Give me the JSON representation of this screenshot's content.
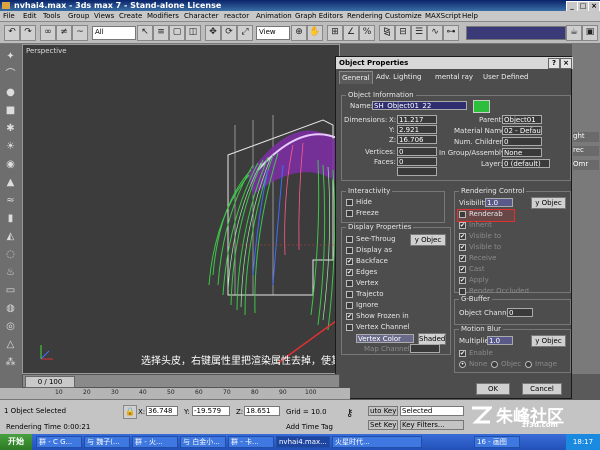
{
  "window": {
    "title": "nvhai4.max - 3ds max 7  - Stand-alone License"
  },
  "menu": [
    "File",
    "Edit",
    "Tools",
    "Group",
    "Views",
    "Create",
    "Modifiers",
    "Character",
    "reactor",
    "Animation",
    "Graph Editors",
    "Rendering",
    "Customize",
    "MAXScript",
    "Help"
  ],
  "toolbar": {
    "selection_filter": "All",
    "ref_coord": "View"
  },
  "viewport": {
    "label": "Perspective",
    "subtitle": "选择头皮，右键属性里把渲染属性去掉，使其不被渲染"
  },
  "right_panel": {
    "labels": [
      "ght",
      "rec",
      "Omr"
    ]
  },
  "dialog": {
    "title": "Object Properties",
    "tabs": [
      "General",
      "Adv. Lighting",
      "mental ray",
      "User Defined"
    ],
    "object_info": {
      "group_title": "Object Information",
      "name_label": "Name:",
      "name_value": "SH_Object01_22",
      "color": "#2dbe3c",
      "dimensions_label": "Dimensions:",
      "x_label": "X:",
      "x": "11.217",
      "y_label": "Y:",
      "y": "2.921",
      "z_label": "Z:",
      "z": "16.706",
      "vertices_label": "Vertices:",
      "vertices": "0",
      "faces_label": "Faces:",
      "faces": "0",
      "parent_label": "Parent:",
      "parent": "Object01",
      "material_label": "Material Name:",
      "material": "02 - Default",
      "children_label": "Num. Children:",
      "children": "0",
      "group_label": "In Group/Assembly:",
      "group": "None",
      "layer_label": "Layer:",
      "layer": "0 (default)"
    },
    "interactivity": {
      "title": "Interactivity",
      "hide": "Hide",
      "freeze": "Freeze"
    },
    "display": {
      "title": "Display Properties",
      "items": [
        "See-Throug",
        "Display as",
        "Backface",
        "Edges",
        "Vertex",
        "Trajecto",
        "Ignore",
        "Show Frozen in",
        "Vertex Channel"
      ],
      "by_object_button": "y Objec",
      "vertex_color": "Vertex Color",
      "shaded_button": "Shaded",
      "map_channel_label": "Map Channel:"
    },
    "rendering": {
      "title": "Rendering Control",
      "visibility_label": "Visibility:",
      "visibility": "1.0",
      "by_object_button": "y Objec",
      "items": [
        "Renderab",
        "Inherit",
        "Visible to",
        "Visible to",
        "Receive",
        "Cast",
        "Apply",
        "Render Occluded"
      ]
    },
    "gbuffer": {
      "title": "G-Buffer",
      "object_channel_label": "Object Channel:",
      "object_channel": "0"
    },
    "motion_blur": {
      "title": "Motion Blur",
      "multiplier_label": "Multiplier:",
      "multiplier": "1.0",
      "by_object_button": "y Objec",
      "enable": "Enable",
      "none": "None",
      "object": "Objec",
      "image": "Image"
    },
    "ok": "OK",
    "cancel": "Cancel"
  },
  "timeline": {
    "frame": "0 / 100",
    "ticks": [
      "10",
      "20",
      "30",
      "40",
      "50",
      "60",
      "70",
      "80",
      "90",
      "100"
    ]
  },
  "status": {
    "selected": "1 Object Selected",
    "rendering_time": "Rendering Time  0:00:21",
    "x_label": "X:",
    "x": "36.748",
    "y_label": "Y:",
    "y": "-19.579",
    "z_label": "Z:",
    "z": "18.651",
    "grid": "Grid = 10.0",
    "add_time_tag": "Add Time Tag",
    "auto_key": "uto Key",
    "set_key": "Set Key",
    "selected_dropdown": "Selected",
    "key_filters": "Key Filters..."
  },
  "taskbar": {
    "start": "开始",
    "tasks": [
      "群 - C G...",
      "与 魏子(...",
      "群 - 火...",
      "与 白金小...",
      "群 - 卡...",
      "nvhai4.max...",
      "火星时代...",
      "16 - 画图"
    ],
    "clock": "18:17"
  },
  "watermark": {
    "text": "朱峰社区",
    "domain": "zf3d.com"
  }
}
